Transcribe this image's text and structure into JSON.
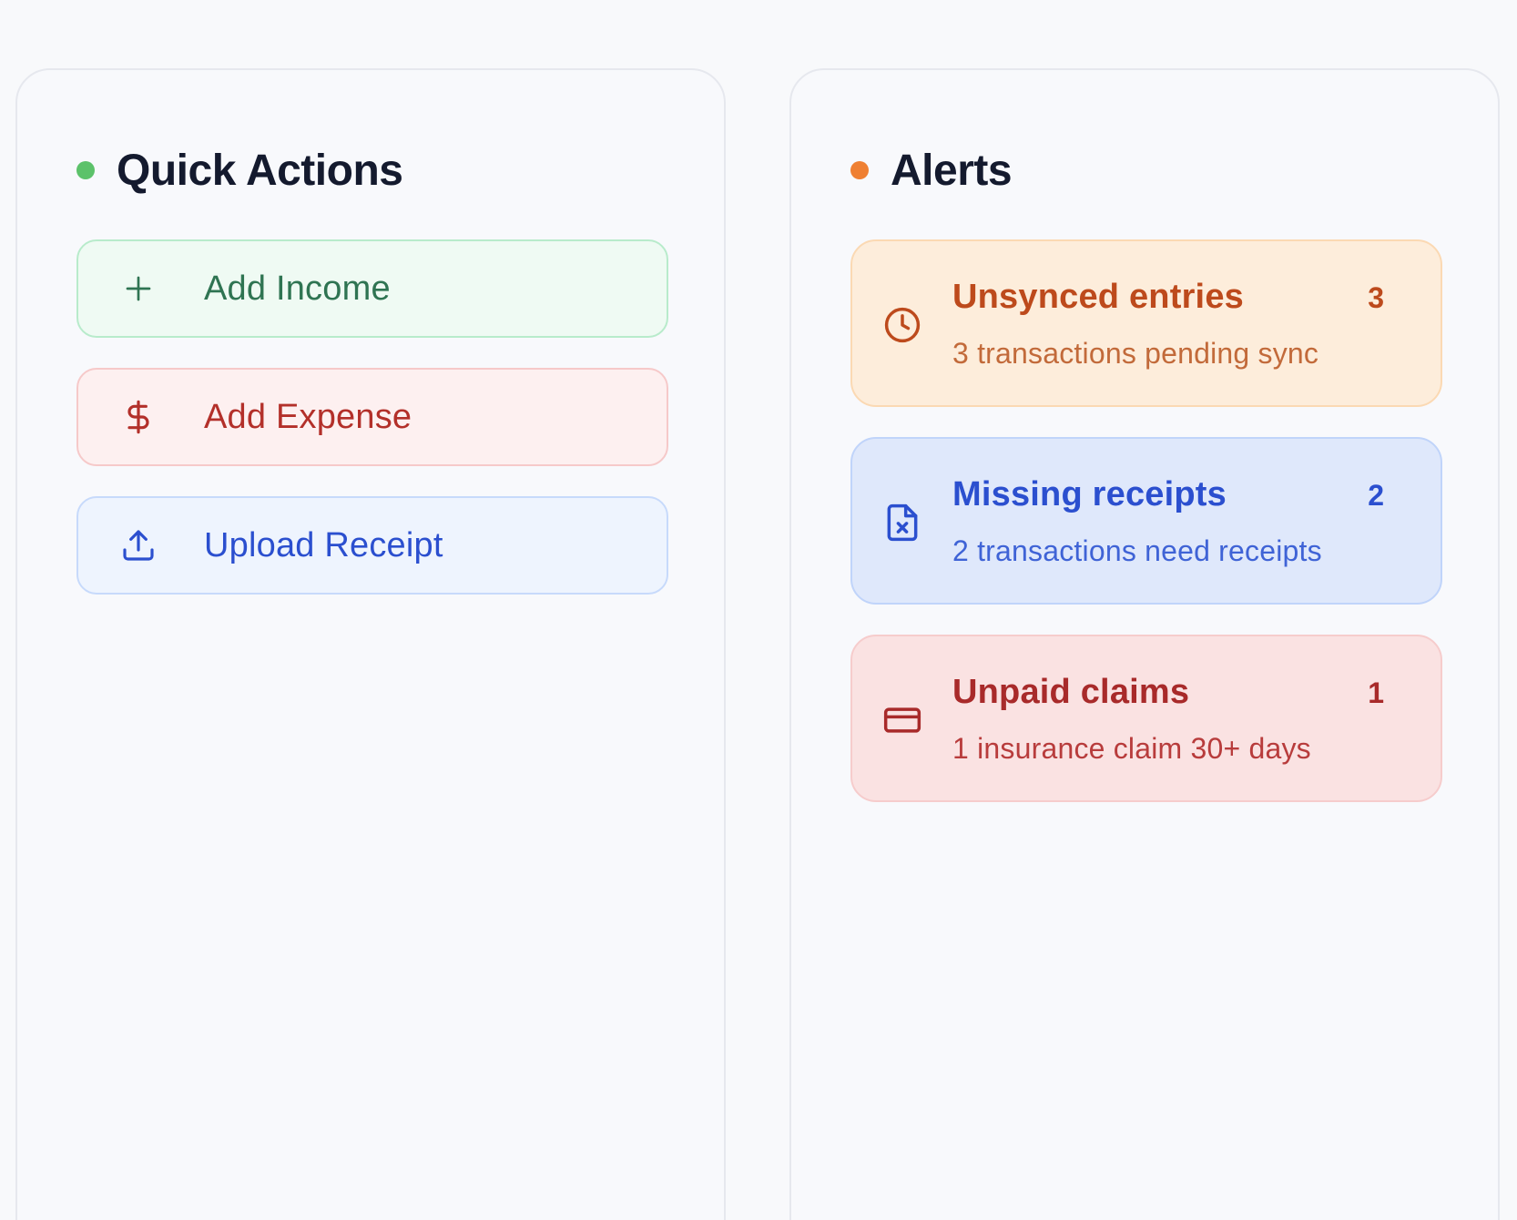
{
  "quick_actions": {
    "title": "Quick Actions",
    "dot_color": "#5cc26a",
    "buttons": [
      {
        "label": "Add Income",
        "icon": "plus-icon",
        "text_color": "#2f7452",
        "bg": "#effaf3",
        "border": "#b8ebcb"
      },
      {
        "label": "Add Expense",
        "icon": "dollar-icon",
        "text_color": "#b3302a",
        "bg": "#fdf0f0",
        "border": "#f6c9c9"
      },
      {
        "label": "Upload Receipt",
        "icon": "upload-icon",
        "text_color": "#2b4fcf",
        "bg": "#eef4fe",
        "border": "#c7dafb"
      }
    ]
  },
  "alerts": {
    "title": "Alerts",
    "dot_color": "#ef8032",
    "items": [
      {
        "title": "Unsynced entries",
        "description": "3 transactions pending sync",
        "count": "3",
        "icon": "clock-icon",
        "title_color": "#bd4a1c",
        "desc_color": "#c26a3a",
        "bg": "#fdeddb",
        "border": "#fbd9b3"
      },
      {
        "title": "Missing receipts",
        "description": "2 transactions need receipts",
        "count": "2",
        "icon": "file-x-icon",
        "title_color": "#2b4fcf",
        "desc_color": "#3f63d6",
        "bg": "#dfe8fb",
        "border": "#c0d4fa"
      },
      {
        "title": "Unpaid claims",
        "description": "1 insurance claim 30+ days",
        "count": "1",
        "icon": "credit-card-icon",
        "title_color": "#a82a2a",
        "desc_color": "#b83c3c",
        "bg": "#fae2e2",
        "border": "#f6cccc"
      }
    ]
  }
}
